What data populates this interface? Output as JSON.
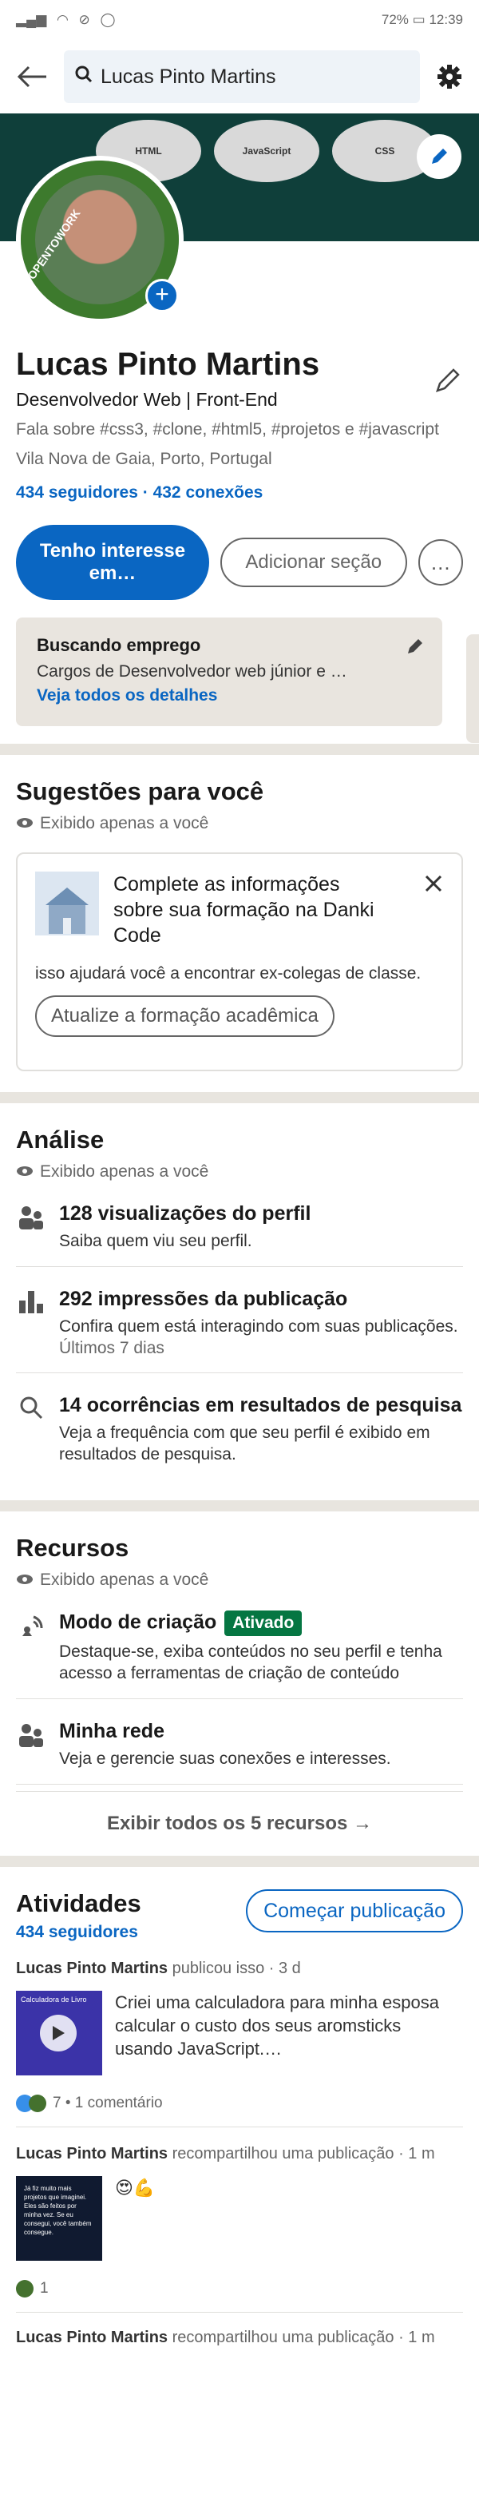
{
  "status_bar": {
    "battery": "72%",
    "time": "12:39"
  },
  "search": {
    "query": "Lucas Pinto Martins"
  },
  "banner": {
    "logos": [
      "HTML",
      "JavaScript",
      "CSS"
    ]
  },
  "avatar": {
    "frame_text": "#OPENTOWORK"
  },
  "profile": {
    "name": "Lucas Pinto Martins",
    "headline": "Desenvolvedor Web | Front-End",
    "about": "Fala sobre #css3, #clone, #html5, #projetos e #javascript",
    "location": "Vila Nova de Gaia, Porto, Portugal",
    "followers": "434 seguidores",
    "separator": " · ",
    "connections": "432 conexões"
  },
  "actions": {
    "primary": "Tenho interesse em…",
    "secondary": "Adicionar seção",
    "more": "…"
  },
  "open_to_work": {
    "title": "Buscando emprego",
    "detail": "Cargos de Desenvolvedor web júnior e …",
    "link": "Veja todos os detalhes"
  },
  "suggestions": {
    "title": "Sugestões para você",
    "private": "Exibido apenas a você",
    "card_title": "Complete as informações sobre sua formação na Danki Code",
    "card_text": "isso ajudará você a encontrar ex-colegas de classe.",
    "card_button": "Atualize a formação acadêmica"
  },
  "analytics": {
    "title": "Análise",
    "private": "Exibido apenas a você",
    "items": [
      {
        "title": "128 visualizações do perfil",
        "desc": "Saiba quem viu seu perfil.",
        "meta": ""
      },
      {
        "title": "292 impressões da publicação",
        "desc": "Confira quem está interagindo com suas publicações.",
        "meta": "Últimos 7 dias"
      },
      {
        "title": "14 ocorrências em resultados de pesquisa",
        "desc": "Veja a frequência com que seu perfil é exibido em resultados de pesquisa.",
        "meta": ""
      }
    ]
  },
  "resources": {
    "title": "Recursos",
    "private": "Exibido apenas a você",
    "items": [
      {
        "title": "Modo de criação",
        "badge": "Ativado",
        "desc": "Destaque-se, exiba conteúdos no seu perfil e tenha acesso a ferramentas de criação de conteúdo"
      },
      {
        "title": "Minha rede",
        "desc": "Veja e gerencie suas conexões e interesses."
      }
    ],
    "show_all": "Exibir todos os 5 recursos →"
  },
  "activity": {
    "title": "Atividades",
    "followers": "434 seguidores",
    "start_button": "Começar publicação",
    "posts": [
      {
        "author": "Lucas Pinto Martins",
        "action": " publicou isso · 3 d",
        "text": "Criei uma calculadora para minha esposa calcular o custo dos seus aromsticks usando JavaScript.…",
        "reactions": "7 • 1 comentário",
        "thumb_text": "Calculadora de Livro"
      },
      {
        "author": "Lucas Pinto Martins",
        "action": " recompartilhou uma publicação · 1 m",
        "text": "😍💪",
        "reactions": "1",
        "thumb_text": "Já fiz muito mais projetos que imaginei. Eles são feitos por minha vez. Se eu consegui, você também consegue."
      },
      {
        "author": "Lucas Pinto Martins",
        "action": " recompartilhou uma publicação · 1 m"
      }
    ]
  }
}
